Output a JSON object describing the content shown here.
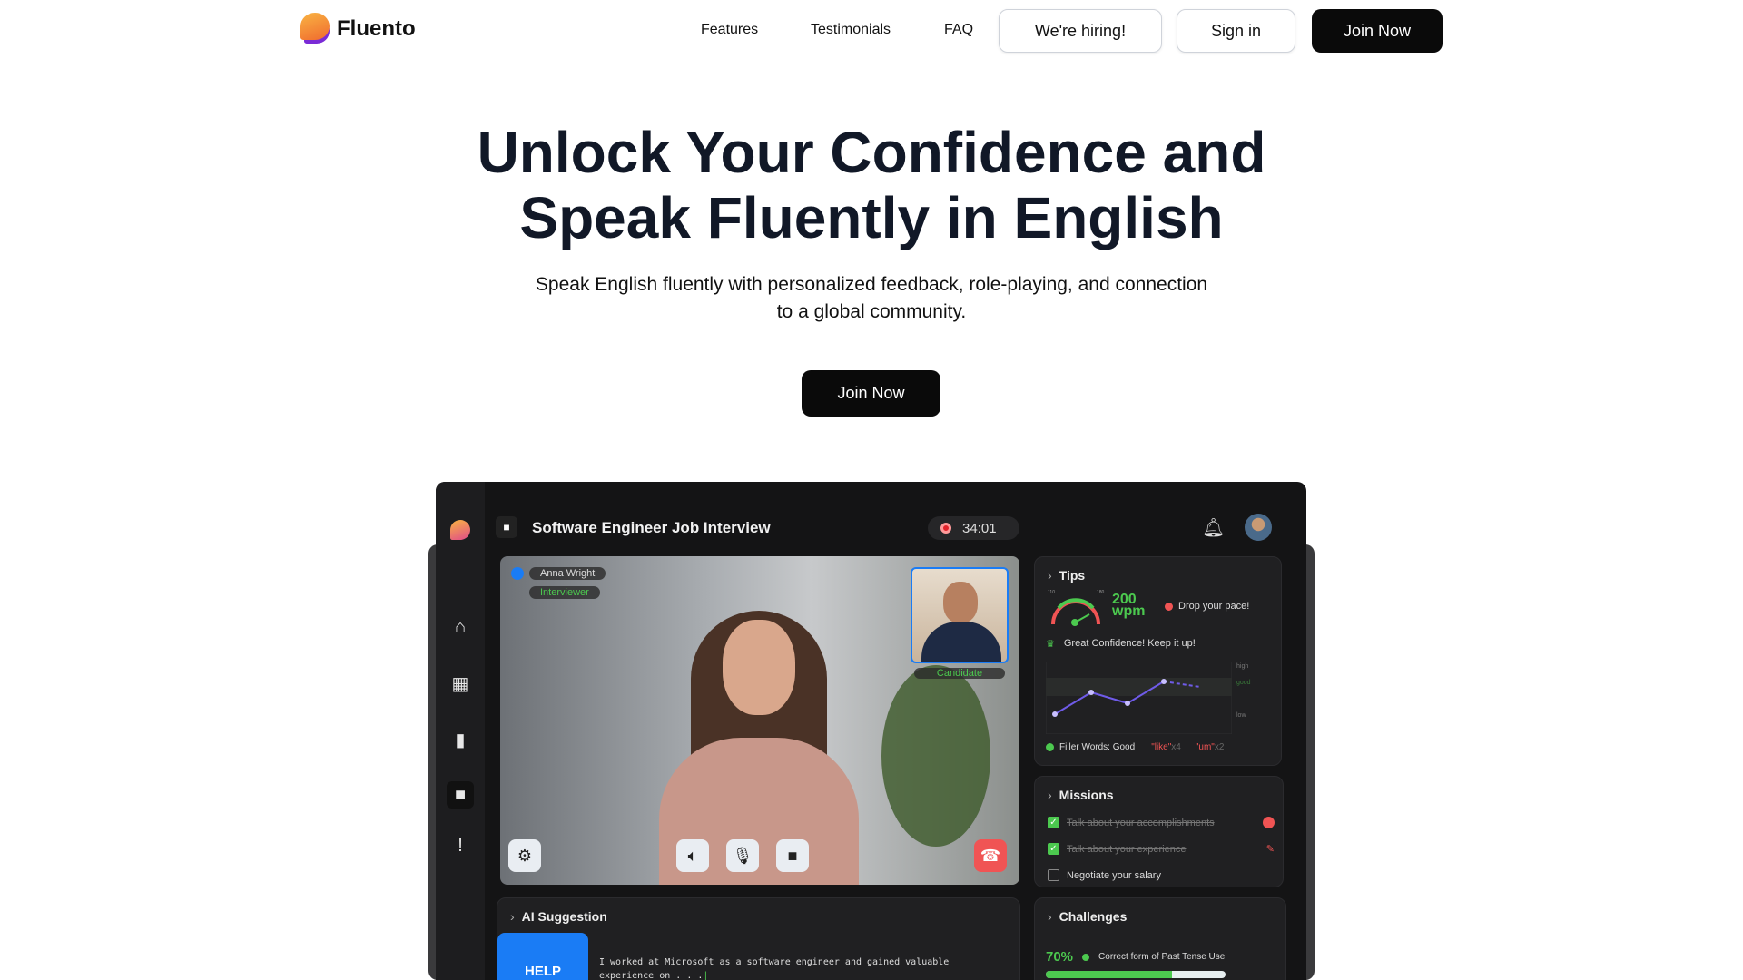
{
  "brand": {
    "name": "Fluento"
  },
  "nav": {
    "features": "Features",
    "testimonials": "Testimonials",
    "faq": "FAQ",
    "hiring": "We're hiring!",
    "signin": "Sign in",
    "join": "Join Now"
  },
  "hero": {
    "title_line1": "Unlock Your Confidence and",
    "title_line2": "Speak Fluently in English",
    "subtitle_line1": "Speak English fluently with personalized feedback, role-playing, and connection",
    "subtitle_line2": "to a global community.",
    "cta": "Join Now"
  },
  "app": {
    "title": "Software Engineer Job Interview",
    "timer": "34:01",
    "video": {
      "interviewer_name": "Anna Wright",
      "interviewer_role": "Interviewer",
      "candidate_label": "Candidate"
    },
    "tips": {
      "title": "Tips",
      "gauge_min": "110",
      "gauge_max": "180",
      "wpm_value": "200",
      "wpm_unit": "wpm",
      "pace_alert": "Drop your pace!",
      "confidence": "Great Confidence! Keep it up!",
      "chart_levels": [
        "high",
        "good",
        "low"
      ],
      "chart_values": [
        1,
        3,
        2,
        4,
        3.5
      ],
      "filler_label": "Filler Words: Good",
      "filler1_word": "\"like\"",
      "filler1_count": "x4",
      "filler2_word": "\"um\"",
      "filler2_count": "x2"
    },
    "missions": {
      "title": "Missions",
      "items": [
        {
          "label": "Talk about your accomplishments",
          "done": true
        },
        {
          "label": "Talk about your experience",
          "done": true
        },
        {
          "label": "Negotiate your salary",
          "done": false
        }
      ]
    },
    "ai": {
      "title": "AI Suggestion",
      "help": "HELP",
      "text_line1": "I worked at Microsoft as a software engineer and gained valuable",
      "text_line2": "experience on . . ."
    },
    "challenges": {
      "title": "Challenges",
      "percent": "70%",
      "progress": 0.7,
      "label": "Correct form of Past Tense Use"
    }
  },
  "colors": {
    "accent_green": "#4cc94f",
    "alert_red": "#f05454",
    "help_blue": "#1a7cf5"
  }
}
